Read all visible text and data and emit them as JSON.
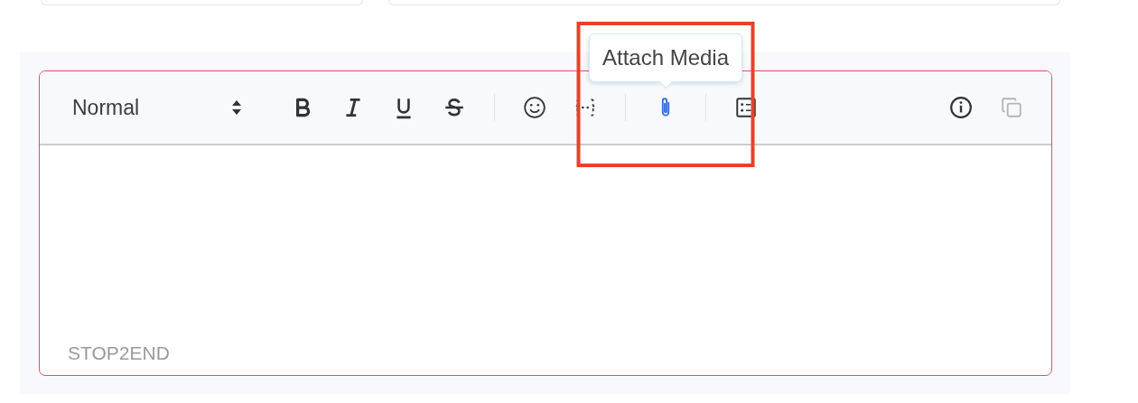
{
  "editor": {
    "format_select": {
      "value": "Normal"
    },
    "tools": [
      {
        "kind": "bold",
        "active": false,
        "disabled": false
      },
      {
        "kind": "italic",
        "active": false,
        "disabled": false
      },
      {
        "kind": "underline",
        "active": false,
        "disabled": false
      },
      {
        "kind": "strike",
        "active": false,
        "disabled": false
      },
      {
        "kind": "divider"
      },
      {
        "kind": "emoji",
        "active": false,
        "disabled": false
      },
      {
        "kind": "variable",
        "active": false,
        "disabled": false
      },
      {
        "kind": "divider"
      },
      {
        "kind": "attach",
        "active": true,
        "disabled": false,
        "highlighted": true,
        "tooltip": "Attach Media"
      },
      {
        "kind": "divider"
      },
      {
        "kind": "list",
        "active": false,
        "disabled": false
      },
      {
        "kind": "spacer"
      },
      {
        "kind": "info",
        "active": false,
        "disabled": false
      },
      {
        "kind": "copy",
        "active": false,
        "disabled": true
      }
    ],
    "footer_label": "STOP2END"
  }
}
